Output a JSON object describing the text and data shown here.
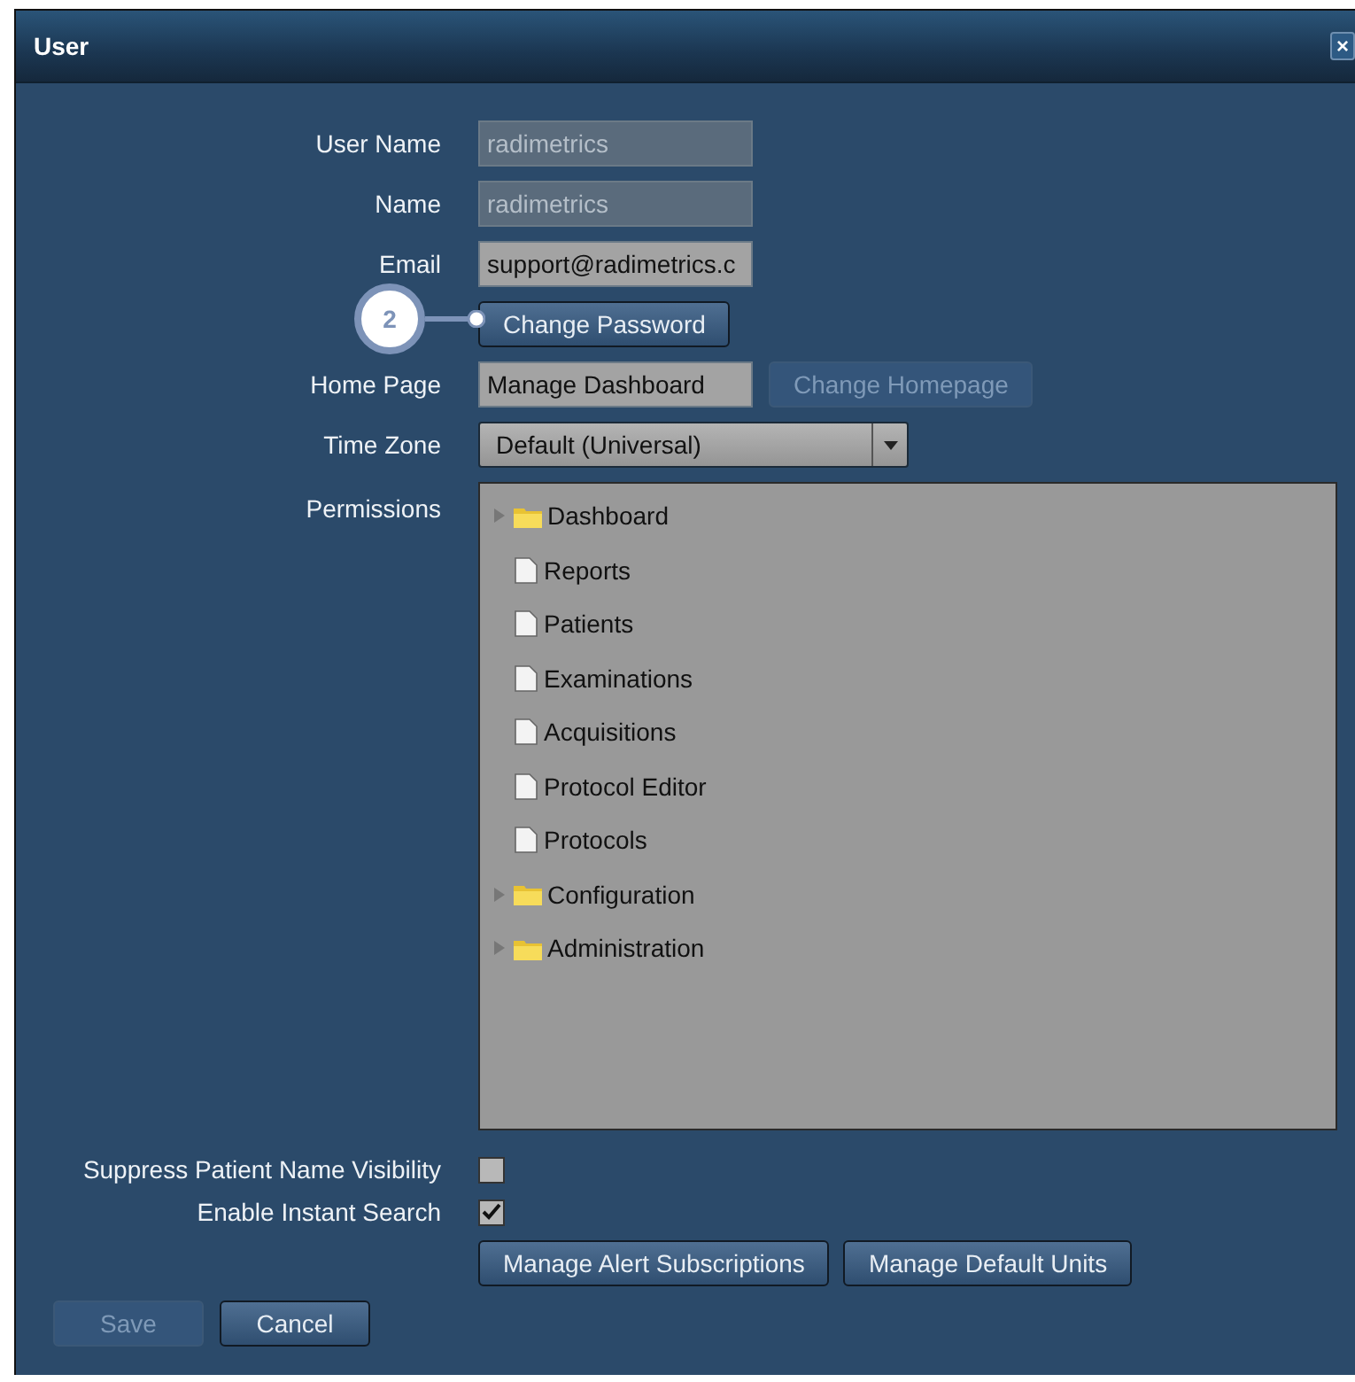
{
  "window": {
    "title": "User",
    "close": "×"
  },
  "fields": [
    {
      "kind": "text",
      "label": "User Name",
      "value": "radimetrics",
      "disabled": true
    },
    {
      "kind": "text",
      "label": "Name",
      "value": "radimetrics",
      "disabled": true
    },
    {
      "kind": "text",
      "label": "Email",
      "value": "support@radimetrics.c",
      "disabled": false
    }
  ],
  "change_password": {
    "label": "Change Password",
    "callout": "2"
  },
  "home_page": {
    "label": "Home Page",
    "value": "Manage Dashboard",
    "button": "Change Homepage",
    "button_disabled": true
  },
  "time_zone": {
    "label": "Time Zone",
    "value": "Default (Universal)"
  },
  "permissions": {
    "label": "Permissions",
    "items": [
      {
        "kind": "folder",
        "label": "Dashboard",
        "expanded": false
      },
      {
        "kind": "file",
        "label": "Reports"
      },
      {
        "kind": "file",
        "label": "Patients"
      },
      {
        "kind": "file",
        "label": "Examinations"
      },
      {
        "kind": "file",
        "label": "Acquisitions"
      },
      {
        "kind": "file",
        "label": "Protocol Editor"
      },
      {
        "kind": "file",
        "label": "Protocols"
      },
      {
        "kind": "folder",
        "label": "Configuration",
        "expanded": false
      },
      {
        "kind": "folder",
        "label": "Administration",
        "expanded": false
      }
    ]
  },
  "checkboxes": [
    {
      "label": "Suppress Patient Name Visibility",
      "checked": false
    },
    {
      "label": "Enable Instant Search",
      "checked": true
    }
  ],
  "actions": [
    {
      "label": "Manage Alert Subscriptions",
      "disabled": false
    },
    {
      "label": "Manage Default Units",
      "disabled": false
    }
  ],
  "footer": [
    {
      "label": "Save",
      "disabled": true
    },
    {
      "label": "Cancel",
      "disabled": false
    }
  ]
}
